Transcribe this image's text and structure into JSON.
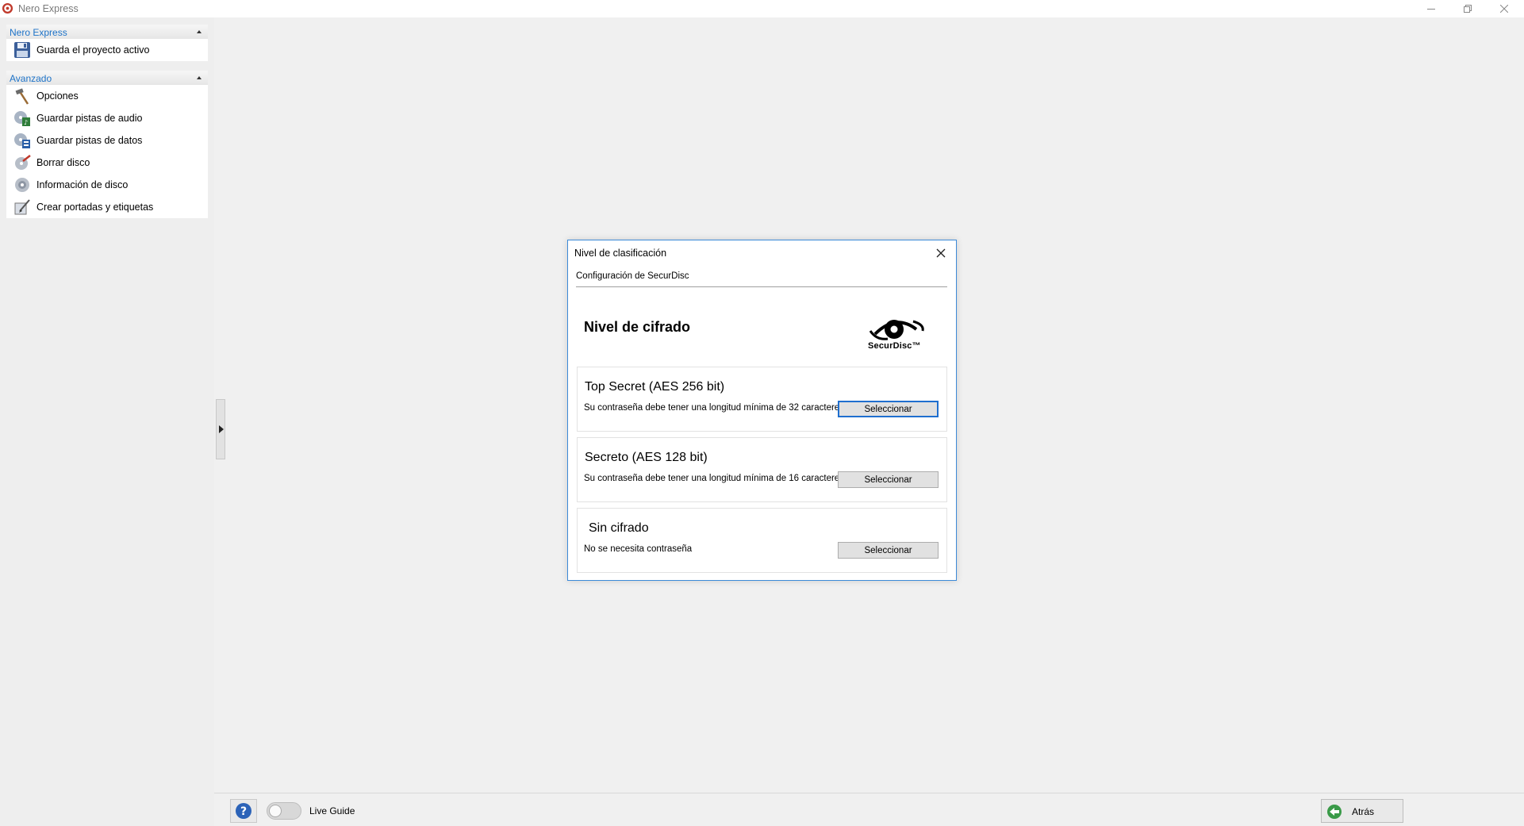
{
  "window": {
    "title": "Nero Express"
  },
  "sidebar": {
    "sections": [
      {
        "header": "Nero Express",
        "items": [
          {
            "label": "Guarda el proyecto activo",
            "icon": "save-disk-icon"
          }
        ]
      },
      {
        "header": "Avanzado",
        "items": [
          {
            "label": "Opciones",
            "icon": "hammer-icon"
          },
          {
            "label": "Guardar pistas de audio",
            "icon": "save-audio-tracks-icon"
          },
          {
            "label": "Guardar pistas de datos",
            "icon": "save-data-tracks-icon"
          },
          {
            "label": "Borrar disco",
            "icon": "erase-disc-icon"
          },
          {
            "label": "Información de disco",
            "icon": "disc-info-icon"
          },
          {
            "label": "Crear portadas y etiquetas",
            "icon": "cover-label-icon"
          }
        ]
      }
    ]
  },
  "dialog": {
    "title": "Nivel de clasificación",
    "section": "Configuración de SecurDisc",
    "heading": "Nivel de cifrado",
    "logo_text": "SecurDisc™",
    "options": [
      {
        "title": "Top Secret (AES 256 bit)",
        "description": "Su contraseña debe tener una longitud mínima de 32 caracteres.",
        "button": "Seleccionar"
      },
      {
        "title": "Secreto (AES 128 bit)",
        "description": "Su contraseña debe tener una longitud mínima de 16 caracteres.",
        "button": "Seleccionar"
      },
      {
        "title": "Sin cifrado",
        "description": "No se necesita contraseña",
        "button": "Seleccionar"
      }
    ]
  },
  "bottombar": {
    "live_guide_label": "Live Guide",
    "live_guide_on": false,
    "back_label": "Atrás"
  },
  "colors": {
    "section_header": "#1e73c8",
    "dialog_border": "#3c8ad8",
    "focus": "#1f6fcf"
  }
}
